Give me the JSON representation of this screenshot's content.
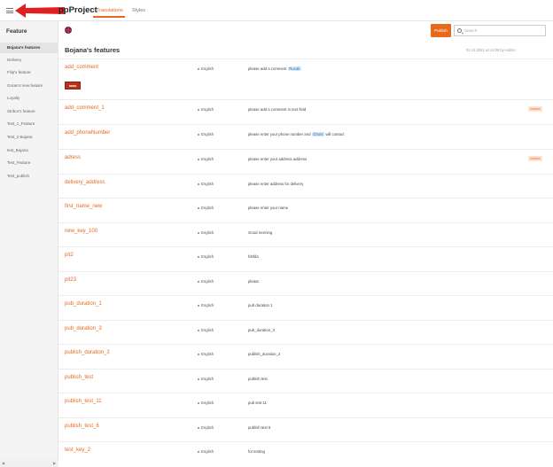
{
  "header": {
    "app_title": "ppProject",
    "tabs": [
      {
        "label": "Translations",
        "active": true
      },
      {
        "label": "Styles",
        "active": false
      }
    ]
  },
  "sidebar": {
    "title": "Feature",
    "items": [
      {
        "label": "Bojana's features",
        "active": true
      },
      {
        "label": "Delivery",
        "active": false
      },
      {
        "label": "Filip's feature",
        "active": false
      },
      {
        "label": "Goran's new feature",
        "active": false
      },
      {
        "label": "Loyalty",
        "active": false
      },
      {
        "label": "Stribor's feature",
        "active": false
      },
      {
        "label": "Test_1_Feature",
        "active": false
      },
      {
        "label": "Test_2 Bojana",
        "active": false
      },
      {
        "label": "test_Bojana",
        "active": false
      },
      {
        "label": "Test_Feature",
        "active": false
      },
      {
        "label": "Test_publish",
        "active": false
      }
    ]
  },
  "toolbar": {
    "publish_label": "Publish",
    "search_placeholder": "Search",
    "language_flag": "uk-flag-icon"
  },
  "page": {
    "title": "Bojana's features",
    "meta": "02.12.2021 at 12:09 by Admin"
  },
  "rows": [
    {
      "key": "add_comment",
      "lang": "English",
      "value_before": "please add a comment ",
      "tag": "Rucak",
      "value_after": "",
      "badge": "",
      "has_image": true
    },
    {
      "key": "add_comment_1",
      "lang": "English",
      "value_before": "please add a comment  in text field",
      "tag": "",
      "value_after": "",
      "badge": "custom",
      "has_image": false
    },
    {
      "key": "add_phoneNumber",
      "lang": "English",
      "value_before": "please enter your phone number and ",
      "tag": "Ghost",
      "value_after": " will contact",
      "badge": "",
      "has_image": false
    },
    {
      "key": "adress",
      "lang": "English",
      "value_before": "please enter your address address",
      "tag": "",
      "value_after": "",
      "badge": "custom",
      "has_image": false
    },
    {
      "key": "delivery_address",
      "lang": "English",
      "value_before": "please enter address for delivery",
      "tag": "",
      "value_after": "",
      "badge": "",
      "has_image": false
    },
    {
      "key": "first_name_new",
      "lang": "English",
      "value_before": "please enter your name",
      "tag": "",
      "value_after": "",
      "badge": "",
      "has_image": false
    },
    {
      "key": "new_key_100",
      "lang": "English",
      "value_before": "Good morning",
      "tag": "",
      "value_after": "",
      "badge": "",
      "has_image": false
    },
    {
      "key": "pit2",
      "lang": "English",
      "value_before": "fdsfda",
      "tag": "",
      "value_after": "",
      "badge": "",
      "has_image": false
    },
    {
      "key": "pit23",
      "lang": "English",
      "value_before": "pleaat",
      "tag": "",
      "value_after": "",
      "badge": "",
      "has_image": false
    },
    {
      "key": "pub_duration_1",
      "lang": "English",
      "value_before": "pub duration 1",
      "tag": "",
      "value_after": "",
      "badge": "",
      "has_image": false
    },
    {
      "key": "pub_duration_3",
      "lang": "English",
      "value_before": "pub_duration_3",
      "tag": "",
      "value_after": "",
      "badge": "",
      "has_image": false
    },
    {
      "key": "publish_duration_2",
      "lang": "English",
      "value_before": "publish_duration_2",
      "tag": "",
      "value_after": "",
      "badge": "",
      "has_image": false
    },
    {
      "key": "publish_test",
      "lang": "English",
      "value_before": "publish test",
      "tag": "",
      "value_after": "",
      "badge": "",
      "has_image": false
    },
    {
      "key": "publish_test_11",
      "lang": "English",
      "value_before": "pub test 11",
      "tag": "",
      "value_after": "",
      "badge": "",
      "has_image": false
    },
    {
      "key": "publish_test_6",
      "lang": "English",
      "value_before": "publish test 6",
      "tag": "",
      "value_after": "",
      "badge": "",
      "has_image": false
    },
    {
      "key": "test_key_2",
      "lang": "English",
      "value_before": "for testing",
      "tag": "",
      "value_after": "",
      "badge": "",
      "has_image": false
    }
  ],
  "colors": {
    "accent": "#e8681c",
    "annotation_arrow": "#e02020"
  }
}
